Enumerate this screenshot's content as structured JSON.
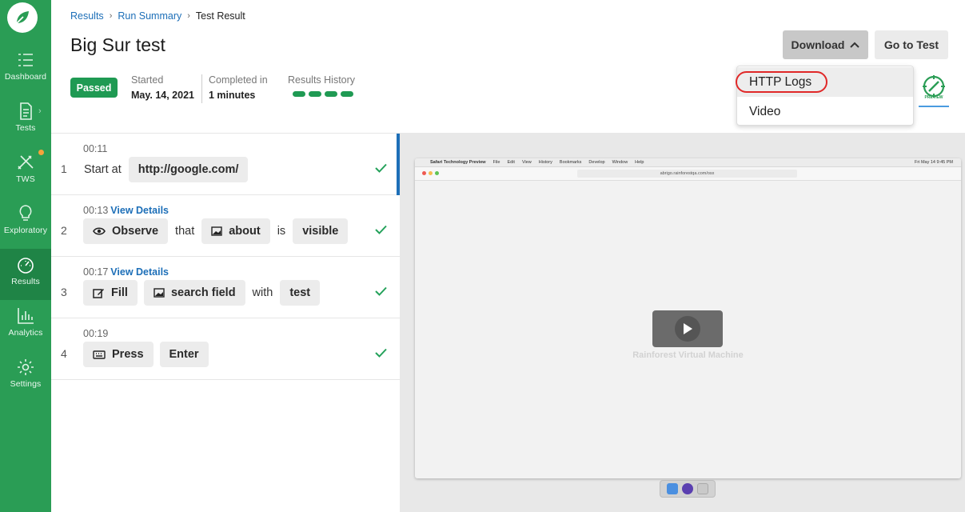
{
  "sidebar": {
    "items": [
      {
        "label": "Dashboard",
        "icon": "dashboard-icon"
      },
      {
        "label": "Tests",
        "icon": "document-icon"
      },
      {
        "label": "TWS",
        "icon": "tws-icon"
      },
      {
        "label": "Exploratory",
        "icon": "lightbulb-icon"
      },
      {
        "label": "Results",
        "icon": "gauge-icon"
      },
      {
        "label": "Analytics",
        "icon": "bar-chart-icon"
      },
      {
        "label": "Settings",
        "icon": "gear-icon"
      }
    ],
    "active": "Results"
  },
  "breadcrumb": {
    "items": [
      "Results",
      "Run Summary",
      "Test Result"
    ]
  },
  "title": "Big Sur test",
  "status": "Passed",
  "started": {
    "label": "Started",
    "value": "May. 14, 2021"
  },
  "completed": {
    "label": "Completed in",
    "value": "1 minutes"
  },
  "history": {
    "label": "Results History",
    "count": 4
  },
  "actions": {
    "download": "Download",
    "goto": "Go to Test"
  },
  "dropdown": {
    "items": [
      "HTTP Logs",
      "Video"
    ]
  },
  "steps": [
    {
      "num": "1",
      "time": "00:11",
      "details": "",
      "tokens": [
        {
          "text": "Start at",
          "chip": false
        },
        {
          "text": "http://google.com/",
          "chip": true
        }
      ]
    },
    {
      "num": "2",
      "time": "00:13",
      "details": "View Details",
      "tokens": [
        {
          "text": "Observe",
          "chip": true,
          "icon": "eye-icon"
        },
        {
          "text": "that",
          "chip": false
        },
        {
          "text": "about",
          "chip": true,
          "icon": "image-icon"
        },
        {
          "text": "is",
          "chip": false
        },
        {
          "text": "visible",
          "chip": true
        }
      ]
    },
    {
      "num": "3",
      "time": "00:17",
      "details": "View Details",
      "tokens": [
        {
          "text": "Fill",
          "chip": true,
          "icon": "edit-icon"
        },
        {
          "text": "search field",
          "chip": true,
          "icon": "image-icon"
        },
        {
          "text": "with",
          "chip": false
        },
        {
          "text": "test",
          "chip": true
        }
      ]
    },
    {
      "num": "4",
      "time": "00:19",
      "details": "",
      "tokens": [
        {
          "text": "Press",
          "chip": true,
          "icon": "keyboard-icon"
        },
        {
          "text": "Enter",
          "chip": true
        }
      ]
    }
  ],
  "video": {
    "vm_label": "Rainforest Virtual Machine",
    "menubar": [
      "Safari Technology Preview",
      "File",
      "Edit",
      "View",
      "History",
      "Bookmarks",
      "Develop",
      "Window",
      "Help"
    ],
    "clock": "Fri May 14  9:45 PM",
    "url": "abrigo.rainforestqa.com/osx"
  },
  "colors": {
    "brand": "#2a9d55",
    "brand_active": "#1f8446",
    "link": "#1d6fb8",
    "pass": "#1f9a53",
    "highlight": "#e02828"
  }
}
